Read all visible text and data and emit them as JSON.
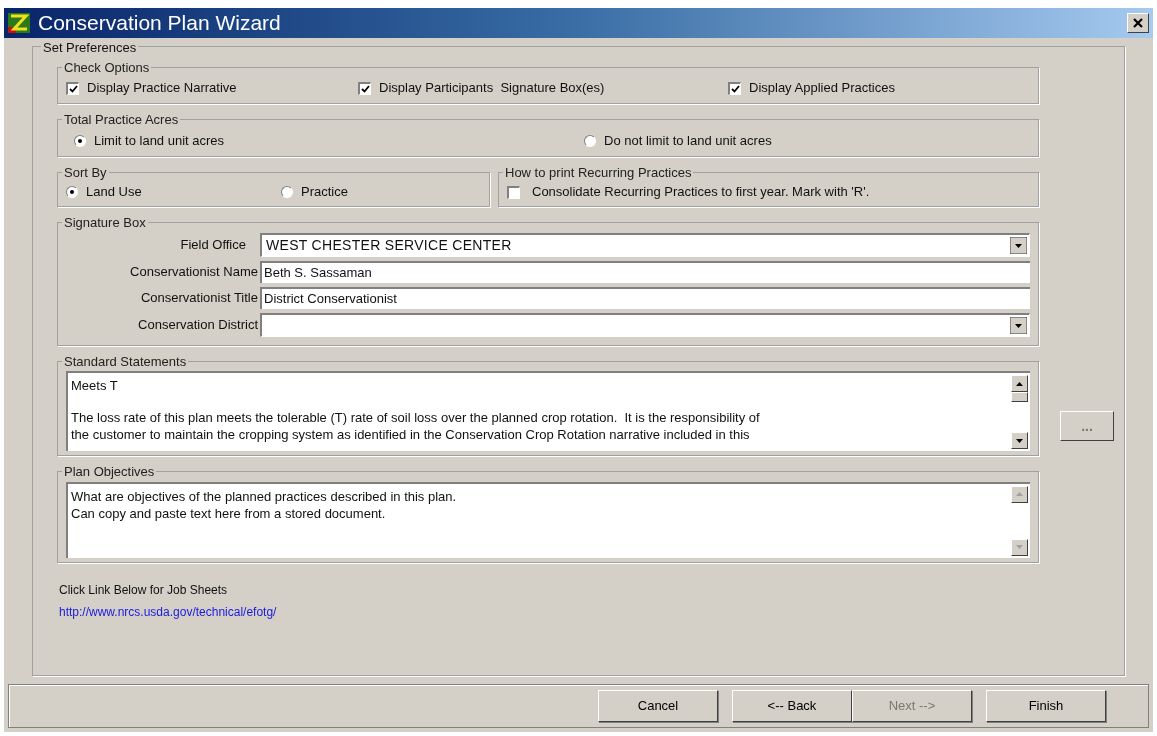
{
  "window": {
    "title": "Conservation Plan Wizard"
  },
  "preferences": {
    "label": "Set Preferences",
    "check_options": {
      "label": "Check Options",
      "items": [
        {
          "label": "Display Practice Narrative",
          "checked": true
        },
        {
          "label": "Display Participants  Signature Box(es)",
          "checked": true
        },
        {
          "label": "Display Applied Practices",
          "checked": true
        }
      ]
    },
    "total_practice_acres": {
      "label": "Total Practice Acres",
      "options": [
        {
          "label": "Limit to land unit acres",
          "selected": true
        },
        {
          "label": "Do not limit to land unit acres",
          "selected": false
        }
      ]
    },
    "sort_by": {
      "label": "Sort By",
      "options": [
        {
          "label": "Land Use",
          "selected": true
        },
        {
          "label": "Practice",
          "selected": false
        }
      ]
    },
    "recurring": {
      "label": "How to print Recurring Practices",
      "option": {
        "label": "Consolidate Recurring Practices to first year. Mark with 'R'.",
        "checked": false
      }
    },
    "signature_box": {
      "label": "Signature Box",
      "fields": [
        {
          "kind": "dropdown",
          "label": "Field Office",
          "value": "WEST CHESTER SERVICE CENTER"
        },
        {
          "kind": "text",
          "label": "Conservationist Name",
          "value": "Beth S. Sassaman"
        },
        {
          "kind": "text",
          "label": "Conservationist Title",
          "value": "District Conservationist"
        },
        {
          "kind": "dropdown",
          "label": "Conservation District"
        }
      ]
    },
    "standard_statements": {
      "label": "Standard Statements",
      "heading": "Meets T",
      "lines": [
        "The loss rate of this plan meets the tolerable (T) rate of soil loss over the planned crop rotation.  It is the responsibility of",
        "the customer to maintain the cropping system as identified in the Conservation Crop Rotation narrative included in this"
      ]
    },
    "more_button": {
      "label": "...",
      "disabled": true
    },
    "plan_objectives": {
      "label": "Plan Objectives",
      "lines": [
        "What are objectives of the planned practices described in this plan.",
        "Can copy and paste text here from a stored document."
      ]
    },
    "job_sheets": {
      "label": "Click Link Below for Job Sheets",
      "link": "http://www.nrcs.usda.gov/technical/efotg/"
    }
  },
  "buttons": [
    {
      "label": "Cancel",
      "disabled": false
    },
    {
      "label": "<-- Back",
      "disabled": false
    },
    {
      "label": "Next -->",
      "disabled": true
    },
    {
      "label": "Finish",
      "disabled": false
    }
  ]
}
